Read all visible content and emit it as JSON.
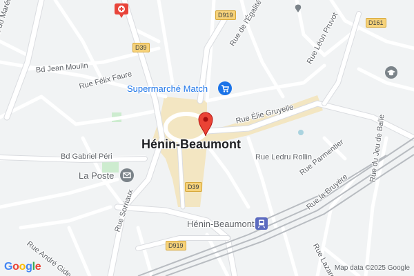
{
  "map": {
    "city_label": "Hénin-Beaumont",
    "streets": {
      "bd_marechal_leclerc": "Bd du Maréchal Leclerc",
      "bd_jean_moulin": "Bd Jean Moulin",
      "rue_felix_faure": "Rue Félix Faure",
      "bd_gabriel_peri": "Bd Gabriel Péri",
      "rue_egalite": "Rue de l'Égalité",
      "rue_leon_pruvot": "Rue Léon Pruvot",
      "rue_elie_gruyelle": "Rue Élie Gruyelle",
      "rue_ledru_rollin": "Rue Ledru Rollin",
      "rue_parmentier": "Rue Parmentier",
      "rue_la_bruyere": "Rue la Bruyère",
      "rue_jeu_de_balle": "Rue du Jeu de Balle",
      "rue_sorriaux": "Rue Sorriaux",
      "rue_andre_gide": "Rue André Gide",
      "rue_lazare_c": "Rue Lazare C"
    },
    "road_shields": {
      "d919_top": "D919",
      "d39_top": "D39",
      "d161": "D161",
      "d39_center": "D39",
      "d919_bottom": "D919"
    },
    "pois": {
      "supermarket": "Supermarché Match",
      "post_office": "La Poste",
      "train_station": "Hénin-Beaumont"
    },
    "attribution": "Map data ©2025 Google",
    "logo_text": "Google",
    "colors": {
      "background": "#f1f3f4",
      "road": "#ffffff",
      "road_outline": "#dadce0",
      "town_center": "#f3e6c2",
      "park": "#cdeccf",
      "water": "#aad3df",
      "rail": "#b8bcc1",
      "poi_blue": "#1a73e8",
      "pin": "#ea4335"
    },
    "icons": {
      "pin": "red-location-pin-icon",
      "hospital": "hospital-cross-icon",
      "shopping": "shopping-cart-icon",
      "mail": "mail-envelope-icon",
      "school": "school-cap-icon",
      "train": "train-icon"
    }
  }
}
